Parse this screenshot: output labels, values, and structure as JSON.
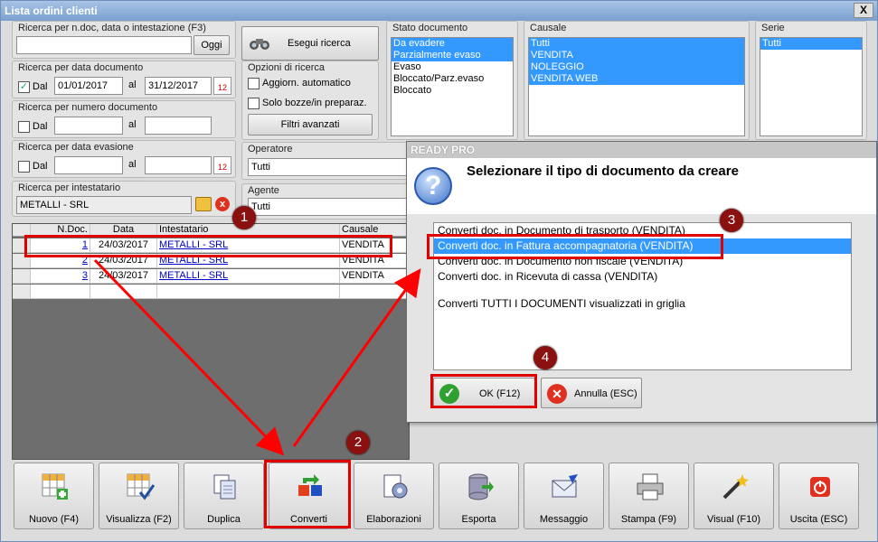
{
  "window": {
    "title": "Lista ordini clienti",
    "close_label": "X"
  },
  "search": {
    "group_label": "Ricerca per n.doc, data o intestazione (F3)",
    "value": "",
    "today_label": "Oggi",
    "run_label": "Esegui ricerca"
  },
  "date_doc": {
    "group_label": "Ricerca per data documento",
    "dal_label": "Dal",
    "al_label": "al",
    "from": "01/01/2017",
    "to": "31/12/2017",
    "checked_mark": "✓"
  },
  "num_doc": {
    "group_label": "Ricerca per numero documento",
    "dal_label": "Dal",
    "al_label": "al",
    "from": "",
    "to": ""
  },
  "date_eva": {
    "group_label": "Ricerca per data evasione",
    "dal_label": "Dal",
    "al_label": "al",
    "from": "",
    "to": ""
  },
  "holder": {
    "group_label": "Ricerca per intestatario",
    "value": "METALLI - SRL"
  },
  "options": {
    "group_label": "Opzioni di ricerca",
    "auto_label": "Aggiorn. automatico",
    "draft_label": "Solo bozze/in preparaz.",
    "advanced_label": "Filtri avanzati"
  },
  "operator": {
    "group_label": "Operatore",
    "value": "Tutti"
  },
  "agent": {
    "group_label": "Agente",
    "value": "Tutti"
  },
  "status": {
    "group_label": "Stato documento",
    "items": [
      "Da evadere",
      "Parzialmente evaso",
      "Evaso",
      "Bloccato/Parz.evaso",
      "Bloccato"
    ]
  },
  "causale": {
    "group_label": "Causale",
    "items": [
      "Tutti",
      "VENDITA",
      "NOLEGGIO",
      "VENDITA WEB"
    ]
  },
  "serie": {
    "group_label": "Serie",
    "items": [
      "Tutti"
    ]
  },
  "grid": {
    "headers": [
      "N.Doc.",
      "Data",
      "Intestatario",
      "Causale"
    ],
    "rows": [
      {
        "num": "1",
        "date": "24/03/2017",
        "holder": "METALLI - SRL",
        "causale": "VENDITA"
      },
      {
        "num": "2",
        "date": "24/03/2017",
        "holder": "METALLI - SRL",
        "causale": "VENDITA"
      },
      {
        "num": "3",
        "date": "24/03/2017",
        "holder": "METALLI - SRL",
        "causale": "VENDITA"
      }
    ]
  },
  "toolbar": {
    "new_label": "Nuovo (F4)",
    "view_label": "Visualizza (F2)",
    "dup_label": "Duplica",
    "convert_label": "Converti",
    "proc_label": "Elaborazioni",
    "export_label": "Esporta",
    "msg_label": "Messaggio",
    "print_label": "Stampa (F9)",
    "visual_label": "Visual (F10)",
    "exit_label": "Uscita (ESC)"
  },
  "dialog": {
    "title": "READY PRO",
    "heading": "Selezionare il tipo di documento da creare",
    "options": [
      "Converti doc. in Documento di trasporto (VENDITA)",
      "Converti doc. in Fattura accompagnatoria (VENDITA)",
      "Converti doc. in Documento non fiscale (VENDITA)",
      "Converti doc. in Ricevuta di cassa (VENDITA)",
      "Converti TUTTI I DOCUMENTI visualizzati in griglia"
    ],
    "ok_label": "OK (F12)",
    "cancel_label": "Annulla (ESC)"
  },
  "annotations": {
    "b1": "1",
    "b2": "2",
    "b3": "3",
    "b4": "4",
    "arrow_color": "#ff0000"
  }
}
